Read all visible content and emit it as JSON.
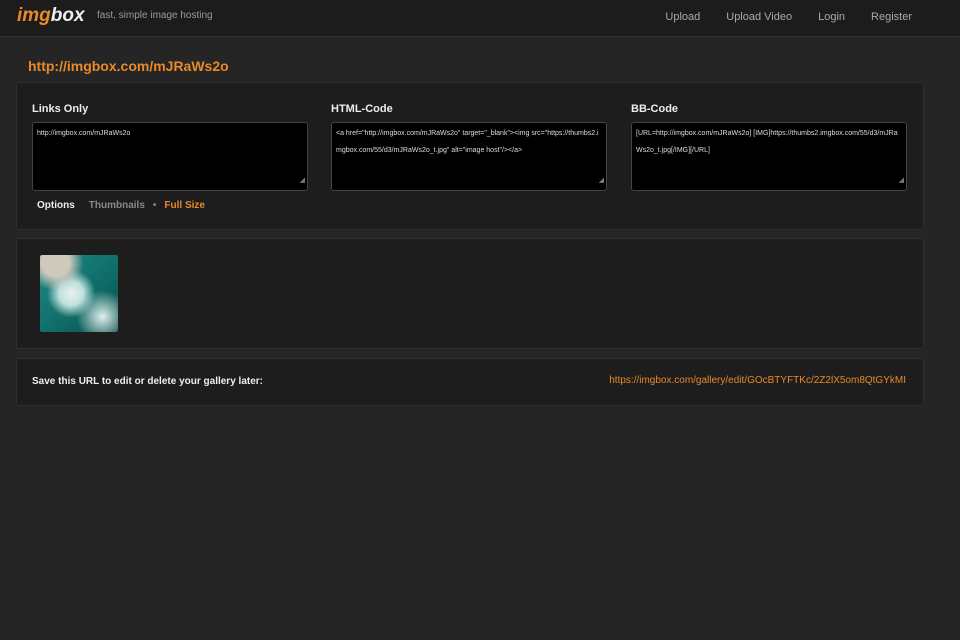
{
  "header": {
    "logo_a": "img",
    "logo_b": "box",
    "tagline": "fast, simple image hosting",
    "nav": [
      "Upload",
      "Upload Video",
      "Login",
      "Register"
    ]
  },
  "gallery_url": "http://imgbox.com/mJRaWs2o",
  "codes": {
    "links": {
      "label": "Links Only",
      "value": "http://imgbox.com/mJRaWs2o"
    },
    "html": {
      "label": "HTML-Code",
      "value": "<a href=\"http://imgbox.com/mJRaWs2o\" target=\"_blank\"><img src=\"https://thumbs2.imgbox.com/55/d3/mJRaWs2o_t.jpg\" alt=\"image host\"/></a>"
    },
    "bb": {
      "label": "BB-Code",
      "value": "[URL=http://imgbox.com/mJRaWs2o] [IMG]https://thumbs2.imgbox.com/55/d3/mJRaWs2o_t.jpg[/IMG][/URL]"
    }
  },
  "options": {
    "label": "Options",
    "thumbnails": "Thumbnails",
    "sep": "•",
    "full": "Full Size"
  },
  "save": {
    "text": "Save this URL to edit or delete your gallery later:",
    "url": "https://imgbox.com/gallery/edit/GOcBTYFTKc/2Z2lX5om8QtGYkMI"
  }
}
